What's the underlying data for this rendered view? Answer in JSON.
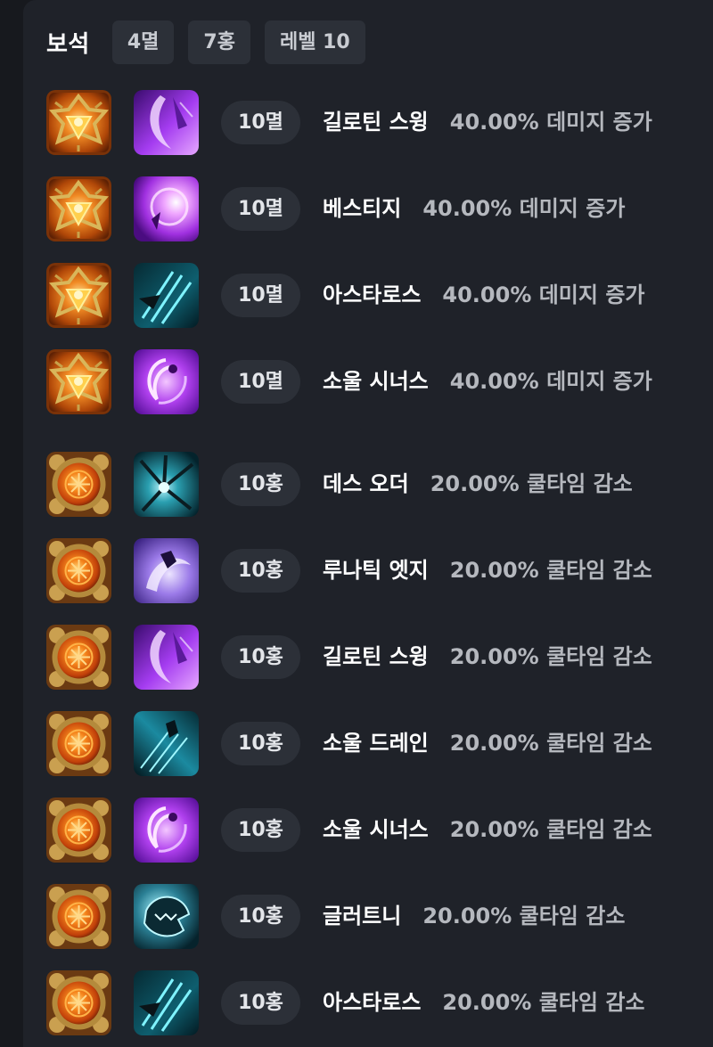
{
  "header": {
    "title": "보석",
    "chips": [
      "4멸",
      "7홍",
      "레벨 10"
    ]
  },
  "rows": [
    {
      "gem": "annihilation-gem",
      "skill": "guillotine-swing",
      "level": "10멸",
      "name": "길로틴 스윙",
      "effect": "40.00% 데미지 증가"
    },
    {
      "gem": "annihilation-gem",
      "skill": "vestige",
      "level": "10멸",
      "name": "베스티지",
      "effect": "40.00% 데미지 증가"
    },
    {
      "gem": "annihilation-gem",
      "skill": "astaroth",
      "level": "10멸",
      "name": "아스타로스",
      "effect": "40.00% 데미지 증가"
    },
    {
      "gem": "annihilation-gem",
      "skill": "soul-synergy",
      "level": "10멸",
      "name": "소울 시너스",
      "effect": "40.00% 데미지 증가"
    },
    {
      "gem": "crimson-flame-gem",
      "skill": "death-order",
      "level": "10홍",
      "name": "데스 오더",
      "effect": "20.00% 쿨타임 감소"
    },
    {
      "gem": "crimson-flame-gem",
      "skill": "lunatic-edge",
      "level": "10홍",
      "name": "루나틱 엣지",
      "effect": "20.00% 쿨타임 감소"
    },
    {
      "gem": "crimson-flame-gem",
      "skill": "guillotine-swing",
      "level": "10홍",
      "name": "길로틴 스윙",
      "effect": "20.00% 쿨타임 감소"
    },
    {
      "gem": "crimson-flame-gem",
      "skill": "soul-drain",
      "level": "10홍",
      "name": "소울 드레인",
      "effect": "20.00% 쿨타임 감소"
    },
    {
      "gem": "crimson-flame-gem",
      "skill": "soul-synergy",
      "level": "10홍",
      "name": "소울 시너스",
      "effect": "20.00% 쿨타임 감소"
    },
    {
      "gem": "crimson-flame-gem",
      "skill": "gluttony",
      "level": "10홍",
      "name": "글러트니",
      "effect": "20.00% 쿨타임 감소"
    },
    {
      "gem": "crimson-flame-gem",
      "skill": "astaroth",
      "level": "10홍",
      "name": "아스타로스",
      "effect": "20.00% 쿨타임 감소"
    }
  ],
  "colors": {
    "background": "#17191e",
    "panel": "#1f2229",
    "chip": "#2c3038",
    "effect_text": "#b5b8be"
  }
}
